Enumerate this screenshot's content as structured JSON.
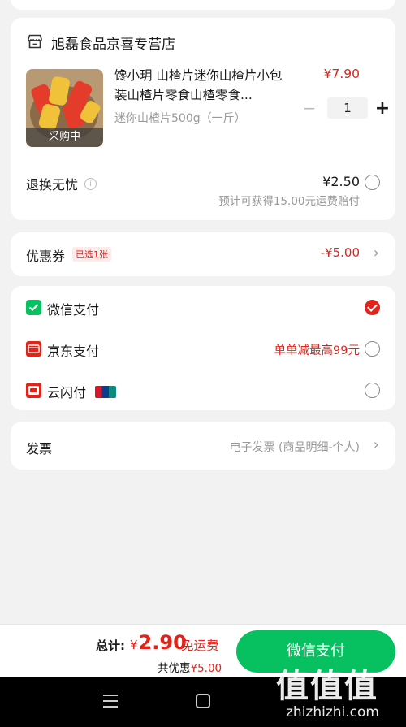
{
  "store": {
    "name": "旭磊食品京喜专营店",
    "product": {
      "title": "馋小玥 山楂片迷你山楂片小包装山楂片零食山楂零食...",
      "price": "¥7.90",
      "spec": "迷你山楂片500g（一斤）",
      "badge": "采购中",
      "quantity": "1",
      "minus": "−",
      "plus": "+"
    },
    "service": {
      "label": "退换无忧",
      "info": "i",
      "price": "¥2.50",
      "note": "预计可获得15.00元运费赔付"
    }
  },
  "coupon": {
    "label": "优惠券",
    "tag": "已选1张",
    "value": "-¥5.00"
  },
  "payment": {
    "options": [
      {
        "label": "微信支付",
        "promo": "",
        "selected": true,
        "icon": "wechat-pay-icon"
      },
      {
        "label": "京东支付",
        "promo": "单单减最高99元",
        "selected": false,
        "icon": "jd-pay-icon"
      },
      {
        "label": "云闪付",
        "promo": "",
        "selected": false,
        "icon": "cloud-quickpass-icon"
      }
    ]
  },
  "invoice": {
    "label": "发票",
    "value": "电子发票 (商品明细-个人)"
  },
  "footer": {
    "total_label": "总计:",
    "currency": "¥",
    "total": "2.90",
    "free_shipping": "免运费",
    "discount_prefix": "共优惠",
    "discount_value": "¥5.00",
    "pay_button": "微信支付"
  },
  "watermark": {
    "big": "值值值",
    "small": "zhizhizhi.com"
  },
  "colors": {
    "accent": "#e2231a",
    "wechat_green": "#07c160"
  }
}
